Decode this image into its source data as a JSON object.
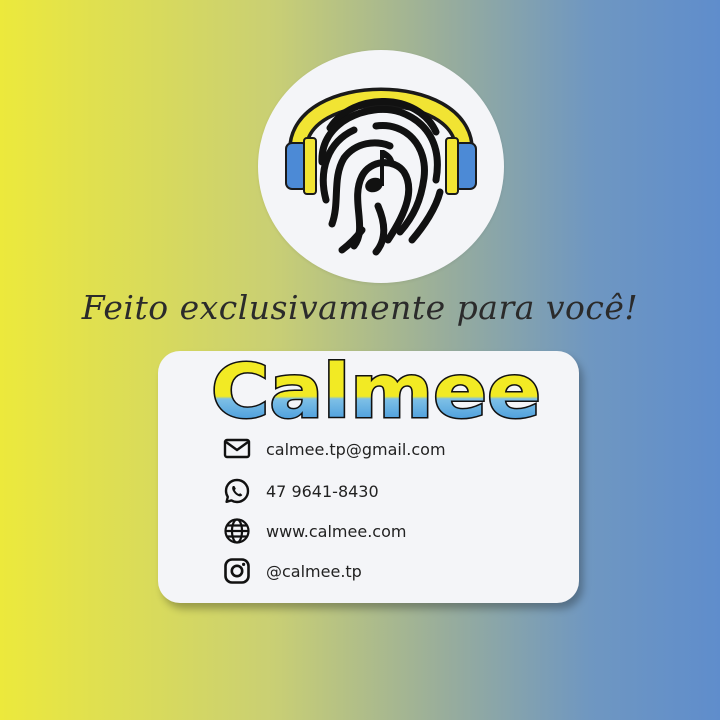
{
  "tagline": "Feito exclusivamente para você!",
  "brand": {
    "name": "Calmee"
  },
  "contacts": [
    {
      "icon": "mail-icon",
      "text": "calmee.tp@gmail.com"
    },
    {
      "icon": "whatsapp-icon",
      "text": "47 9641-8430"
    },
    {
      "icon": "globe-icon",
      "text": "www.calmee.com"
    },
    {
      "icon": "instagram-icon",
      "text": "@calmee.tp"
    }
  ],
  "colors": {
    "yellow": "#ece93c",
    "blue": "#5f8dcc",
    "headphone_yellow": "#f1e433",
    "headphone_blue": "#4c8ad6",
    "card": "#f4f5f8"
  }
}
